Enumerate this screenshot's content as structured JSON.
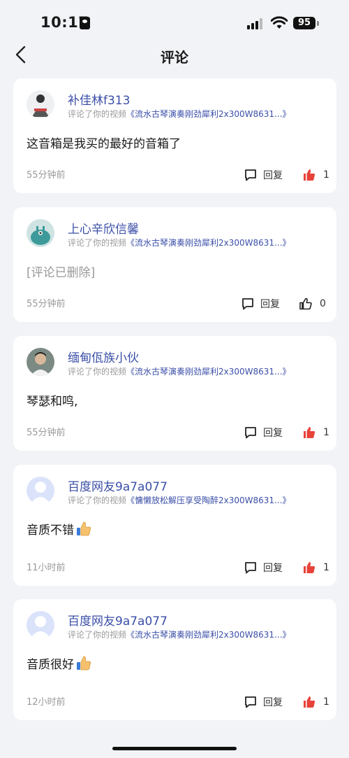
{
  "status_bar": {
    "time": "10:17",
    "battery": "95"
  },
  "nav": {
    "title": "评论"
  },
  "comments": [
    {
      "username": "补佳林f313",
      "action": "评论了你的视频",
      "video_title": "《流水古琴演奏刚劲犀利2x300W8631...》",
      "content": "这音箱是我买的最好的音箱了",
      "time": "55分钟前",
      "reply_label": "回复",
      "likes": "1",
      "liked": true
    },
    {
      "username": "上心辛欣信馨",
      "action": "评论了你的视频",
      "video_title": "《流水古琴演奏刚劲犀利2x300W8631...》",
      "content": "[评论已删除]",
      "time": "55分钟前",
      "reply_label": "回复",
      "likes": "0",
      "liked": false
    },
    {
      "username": "缅甸佤族小伙",
      "action": "评论了你的视频",
      "video_title": "《流水古琴演奏刚劲犀利2x300W8631...》",
      "content": "琴瑟和鸣,",
      "time": "55分钟前",
      "reply_label": "回复",
      "likes": "1",
      "liked": true
    },
    {
      "username": "百度网友9a7a077",
      "action": "评论了你的视频",
      "video_title": "《慵懒放松解压享受陶醉2x300W8631...》",
      "content": "音质不错",
      "time": "11小时前",
      "reply_label": "回复",
      "likes": "1",
      "liked": true
    },
    {
      "username": "百度网友9a7a077",
      "action": "评论了你的视频",
      "video_title": "《流水古琴演奏刚劲犀利2x300W8631...》",
      "content": "音质很好",
      "time": "12小时前",
      "reply_label": "回复",
      "likes": "1",
      "liked": true
    }
  ],
  "colors": {
    "link": "#3b4fa8",
    "liked": "#e8433a",
    "background": "#f2f3f7"
  }
}
